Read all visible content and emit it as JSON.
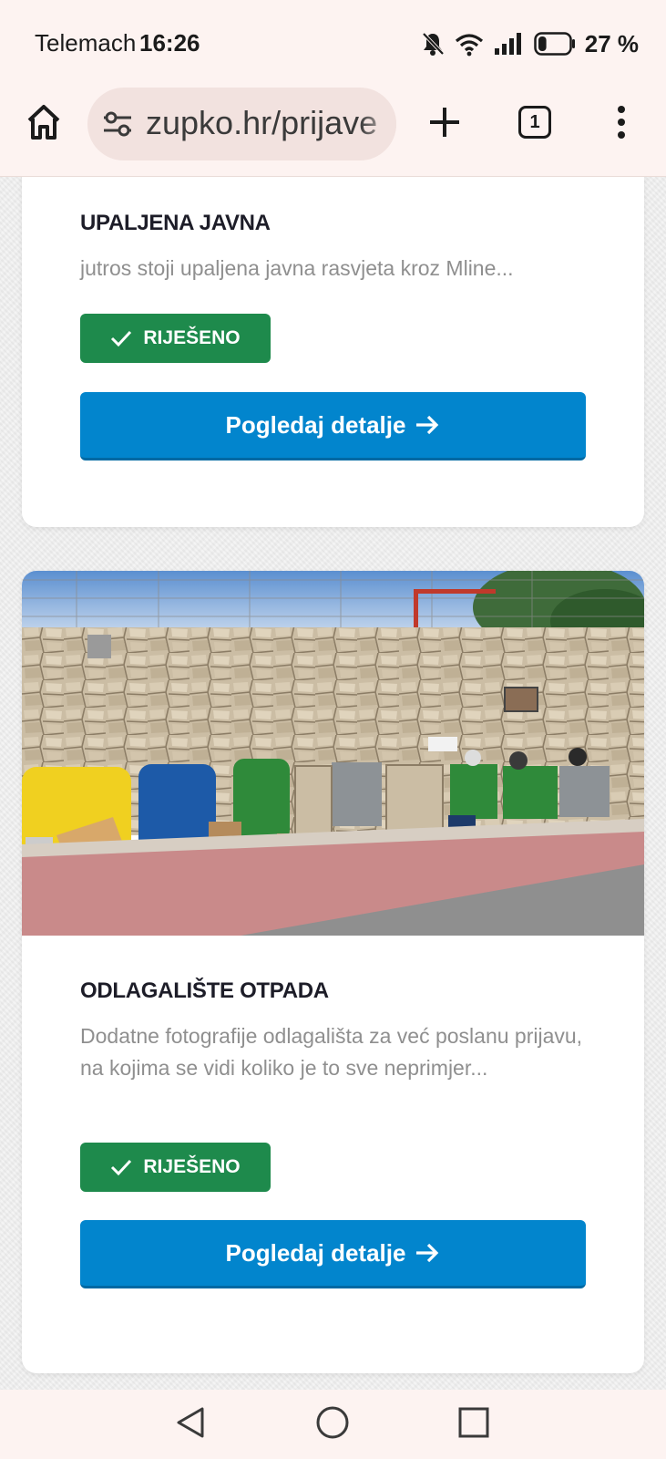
{
  "status_bar": {
    "carrier": "Telemach",
    "time": "16:26",
    "battery_percent": "27 %",
    "battery_level": 0.27,
    "icons": [
      "bell-muted-icon",
      "wifi-icon",
      "signal-icon",
      "battery-icon"
    ]
  },
  "browser": {
    "url": "zupko.hr/prijave",
    "tab_count": "1",
    "icons": [
      "home-icon",
      "site-settings-icon",
      "plus-icon",
      "tabs-icon",
      "more-vert-icon"
    ]
  },
  "reports": [
    {
      "title": "UPALJENA JAVNA",
      "description": "jutros stoji upaljena javna rasvjeta kroz Mline...",
      "status": "RIJEŠENO",
      "button": "Pogledaj detalje"
    },
    {
      "title": "ODLAGALIŠTE OTPADA",
      "description": "Dodatne fotografije odlagališta za već poslanu prijavu, na kojima se vidi koliko je to sve neprimjer...",
      "status": "RIJEŠENO",
      "button": "Pogledaj detalje"
    }
  ],
  "colors": {
    "status_green": "#1e8a4c",
    "button_blue": "#0285cd",
    "chrome_bg": "#fdf3f1"
  },
  "nav": {
    "icons": [
      "back-icon",
      "home-circle-icon",
      "recents-icon"
    ]
  }
}
